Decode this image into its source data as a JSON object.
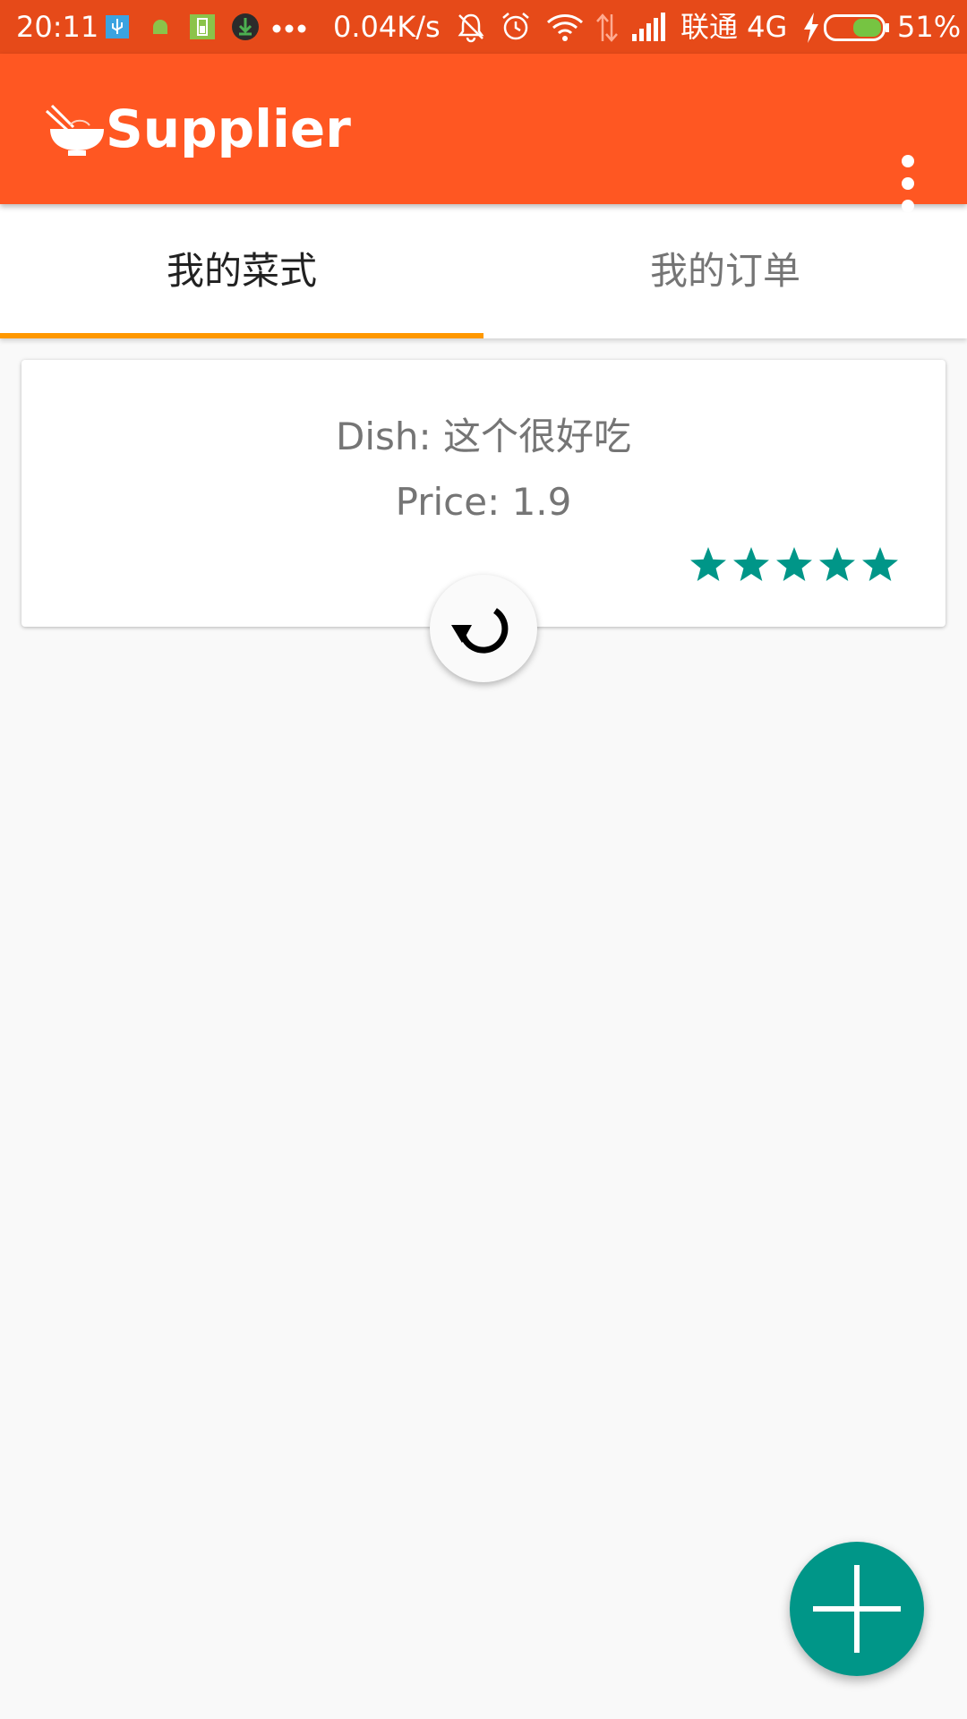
{
  "status_bar": {
    "time": "20:11",
    "network_speed": "0.04K/s",
    "carrier": "联通 4G",
    "battery": "51%",
    "icons": [
      "usb-icon",
      "android-icon",
      "battery-saver-icon",
      "download-icon",
      "more-notifications-icon",
      "mute-icon",
      "alarm-icon",
      "wifi-icon",
      "data-arrows-icon",
      "signal-icon",
      "charging-icon",
      "battery-icon"
    ]
  },
  "app_bar": {
    "title": "Supplier",
    "logo_icon": "noodle-bowl-icon",
    "menu_icon": "overflow-menu-icon"
  },
  "tabs": [
    {
      "label": "我的菜式",
      "selected": true
    },
    {
      "label": "我的订单",
      "selected": false
    }
  ],
  "dish_card": {
    "dish": "Dish: 这个很好吃",
    "price": "Price: 1.9",
    "rating": 5,
    "rating_max": 5
  },
  "refresh_icon": "refresh-icon",
  "fab_icon": "plus-icon",
  "colors": {
    "status_bar": "#e64a19",
    "app_bar": "#ff5722",
    "tab_indicator": "#ff9800",
    "accent": "#009688",
    "star": "#009688"
  }
}
